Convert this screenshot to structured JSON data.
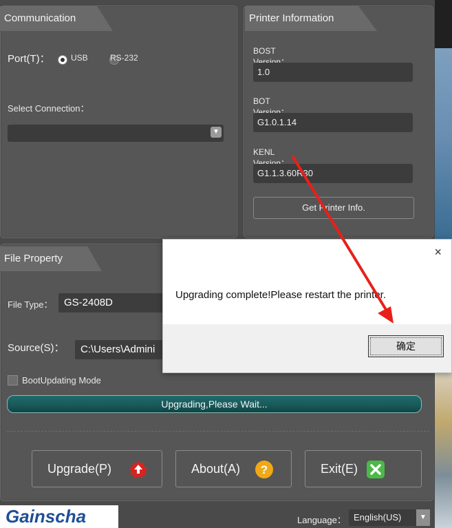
{
  "communication": {
    "tab_title": "Communication",
    "port_label": "Port(T)：",
    "port_options": [
      "USB",
      "RS-232"
    ],
    "selected_port": "USB",
    "select_connection_label": "Select Connection：",
    "connection_value": ""
  },
  "printer_info": {
    "tab_title": "Printer Information",
    "bost_label": "BOST Version：",
    "bost_value": "1.0",
    "bot_label": "BOT Version：",
    "bot_value": "G1.0.1.14",
    "kenl_label": "KENL Version：",
    "kenl_value": "G1.1.3.60R30",
    "get_info_button": "Get Printer Info."
  },
  "file_property": {
    "tab_title": "File Property",
    "file_type_label": "File Type：",
    "file_type_value": "GS-2408D",
    "source_label": "Source(S)：",
    "source_value": "C:\\Users\\Admini",
    "boot_mode_label": "BootUpdating Mode",
    "boot_mode_checked": false
  },
  "progress": {
    "text": "Upgrading,Please Wait...",
    "value": 1.0
  },
  "buttons": {
    "upgrade": "Upgrade(P)",
    "about": "About(A)",
    "exit": "Exit(E)"
  },
  "footer": {
    "brand": "Gainscha",
    "language_label": "Language：",
    "language_value": "English(US)"
  },
  "dialog": {
    "message": "Upgrading complete!Please restart the printer.",
    "ok_button": "确定",
    "close_glyph": "×"
  },
  "colors": {
    "panel": "#565656",
    "progress_fill": "#1a5a5a",
    "annotation_arrow": "#e8201a",
    "upgrade_icon": "#d8231f",
    "about_icon": "#f0a916",
    "exit_icon": "#4cb848"
  },
  "icons": {
    "upgrade": "up-arrow-gear-icon",
    "about": "question-icon",
    "exit": "x-close-icon"
  }
}
